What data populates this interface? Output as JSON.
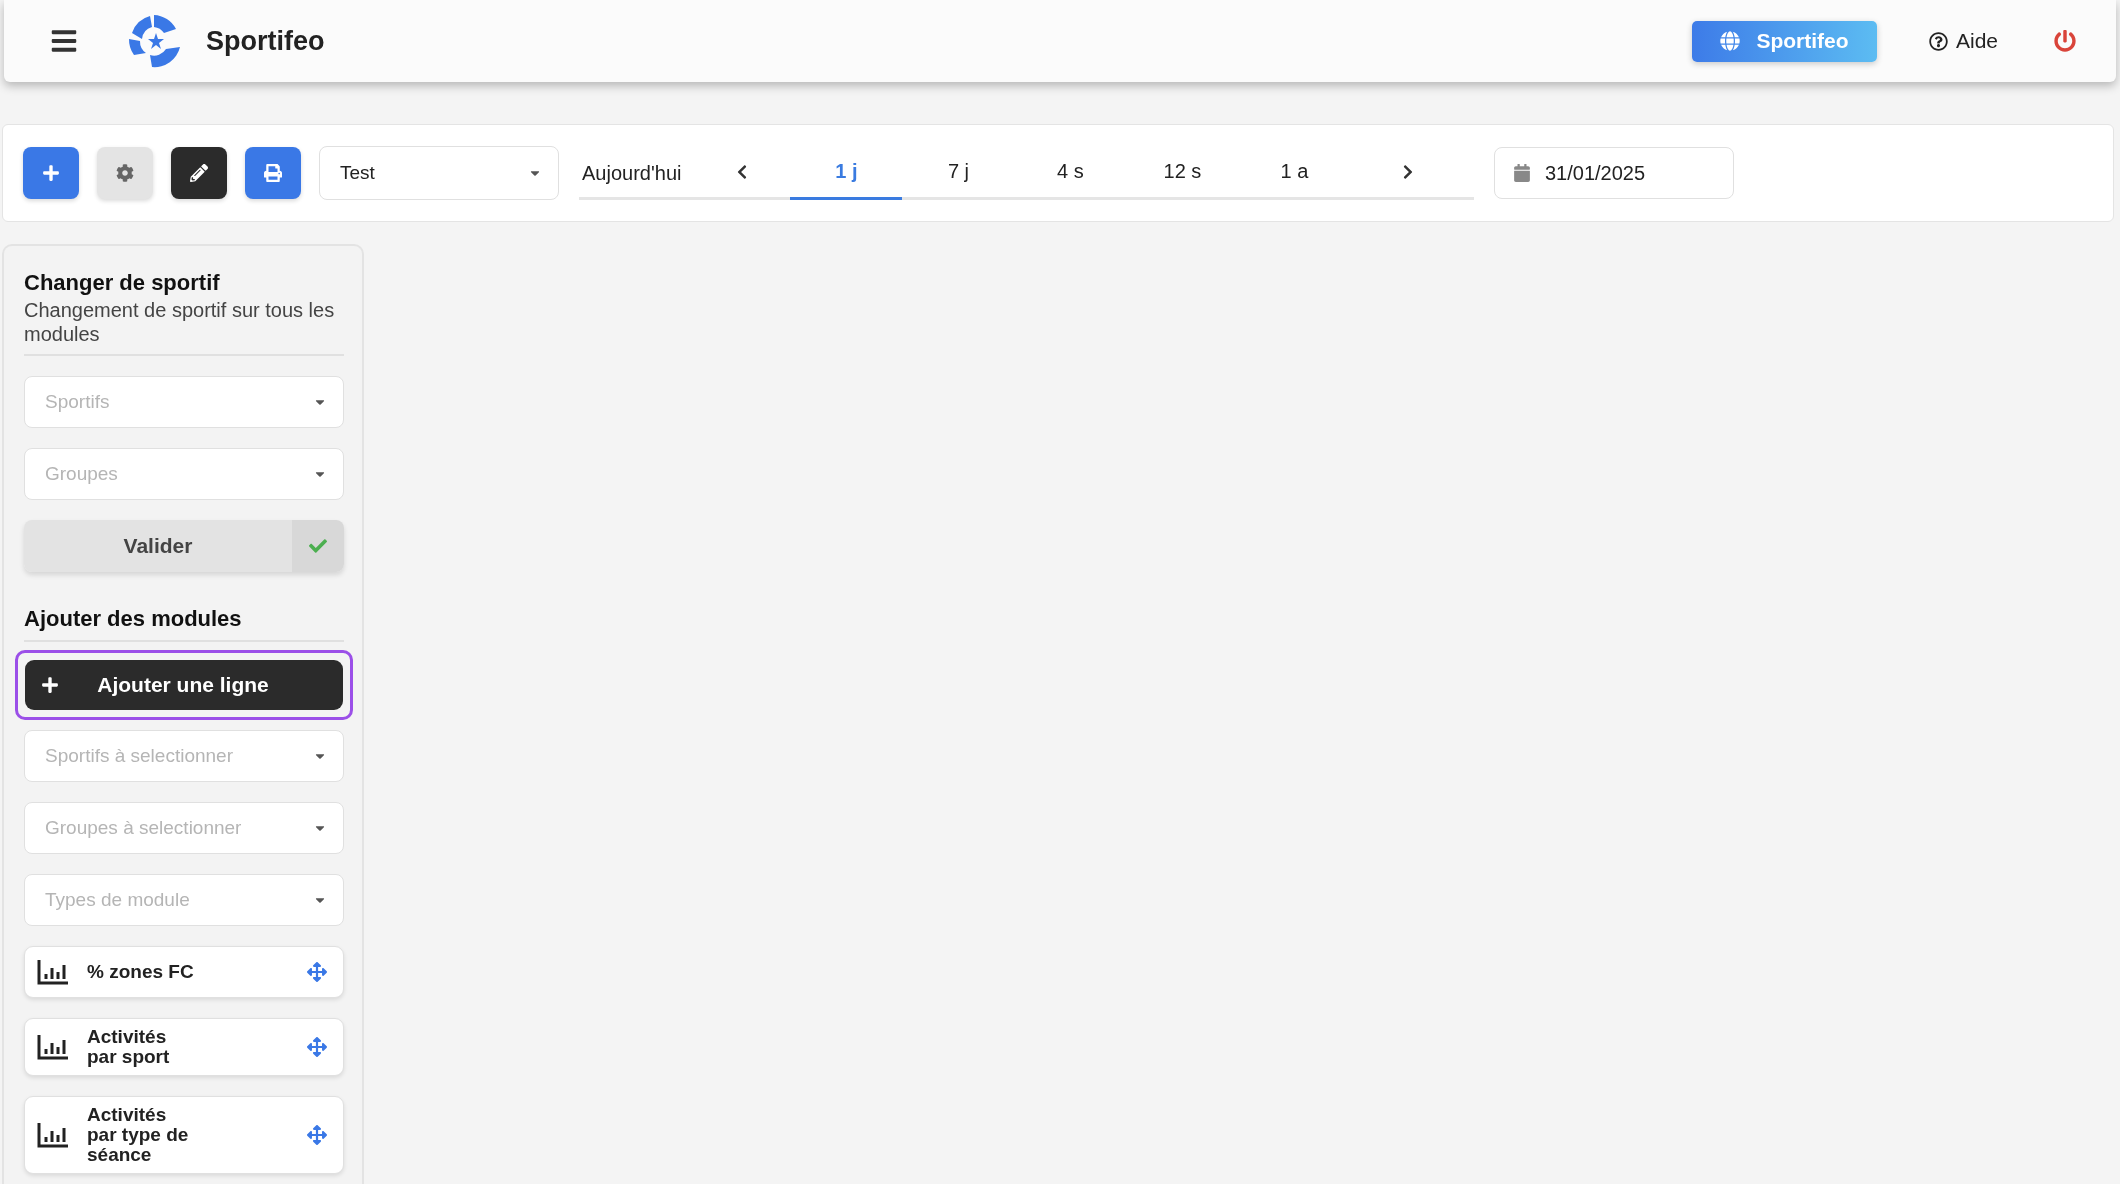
{
  "header": {
    "title": "Sportifeo",
    "workspace_button": "Sportifeo",
    "help": "Aide"
  },
  "toolbar": {
    "view_select": "Test",
    "today": "Aujourd'hui",
    "periods": [
      {
        "label": "1 j",
        "selected": true
      },
      {
        "label": "7 j",
        "selected": false
      },
      {
        "label": "4 s",
        "selected": false
      },
      {
        "label": "12 s",
        "selected": false
      },
      {
        "label": "1 a",
        "selected": false
      }
    ],
    "date": "31/01/2025"
  },
  "sidebar": {
    "change_section": {
      "title": "Changer de sportif",
      "subtitle": "Changement de sportif sur tous les modules",
      "fields": [
        {
          "placeholder": "Sportifs"
        },
        {
          "placeholder": "Groupes"
        }
      ],
      "validate_button": "Valider"
    },
    "add_section": {
      "title": "Ajouter des modules",
      "add_row_button": {
        "label": "Ajouter une ligne",
        "focused": true
      },
      "fields": [
        {
          "placeholder": "Sportifs à selectionner"
        },
        {
          "placeholder": "Groupes à selectionner"
        },
        {
          "placeholder": "Types de module"
        }
      ],
      "modules": [
        {
          "label": "% zones FC"
        },
        {
          "label": "Activités par sport"
        },
        {
          "label": "Activités par type de séance"
        }
      ]
    }
  }
}
